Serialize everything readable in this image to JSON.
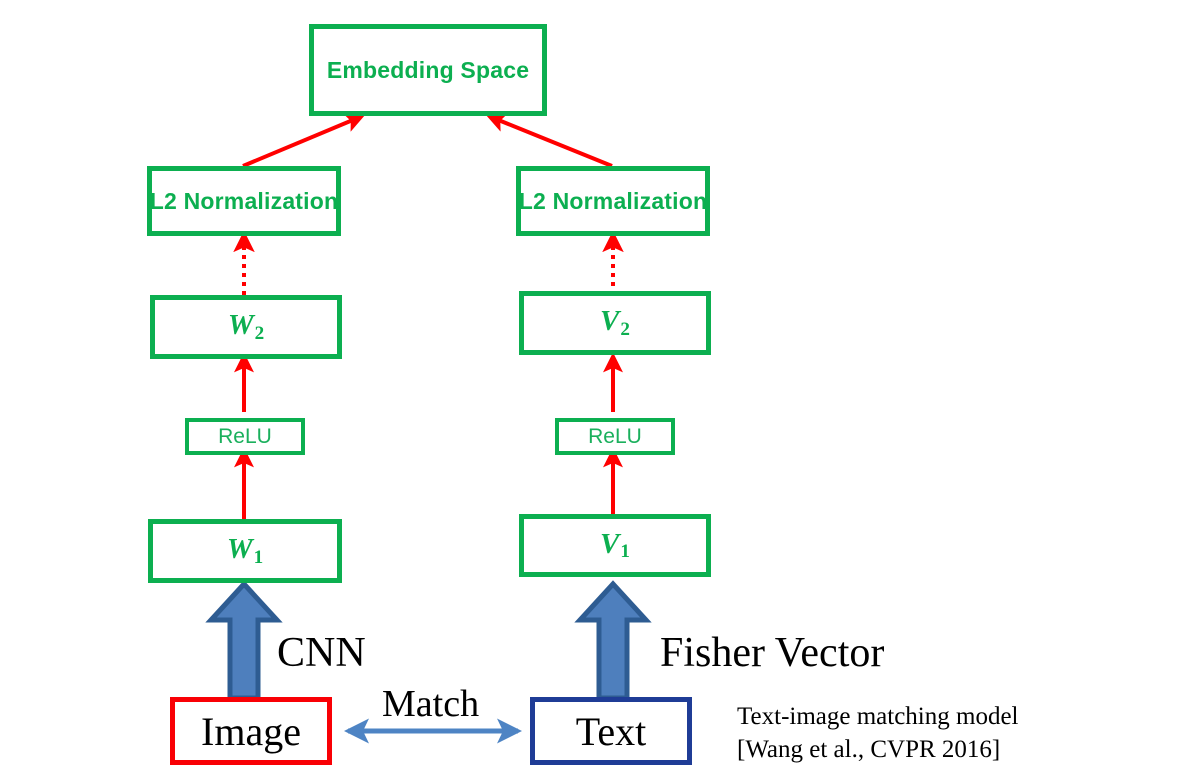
{
  "diagram": {
    "title": "Text-image matching model",
    "colors": {
      "green": "#0CAF50",
      "red_arrow": "#FF0000",
      "image_box_border": "#F90005",
      "text_box_border": "#1F3C96",
      "thick_arrow_fill": "#4E7FBD",
      "thick_arrow_stroke": "#2E5C92",
      "match_arrow": "#4E84C4",
      "black": "#000000"
    },
    "nodes": {
      "embedding_space": {
        "label": "Embedding Space"
      },
      "l2_norm_left": {
        "label": "L2 Normalization"
      },
      "l2_norm_right": {
        "label": "L2 Normalization"
      },
      "w2": {
        "label": "W",
        "sub": "2"
      },
      "v2": {
        "label": "V",
        "sub": "2"
      },
      "relu_left": {
        "label": "ReLU"
      },
      "relu_right": {
        "label": "ReLU"
      },
      "w1": {
        "label": "W",
        "sub": "1"
      },
      "v1": {
        "label": "V",
        "sub": "1"
      },
      "image": {
        "label": "Image"
      },
      "text": {
        "label": "Text"
      }
    },
    "annotations": {
      "cnn": "CNN",
      "fisher_vector": "Fisher Vector",
      "match": "Match",
      "caption_line1": "Text-image matching  model",
      "caption_line2": "[Wang et al., CVPR 2016]"
    }
  }
}
